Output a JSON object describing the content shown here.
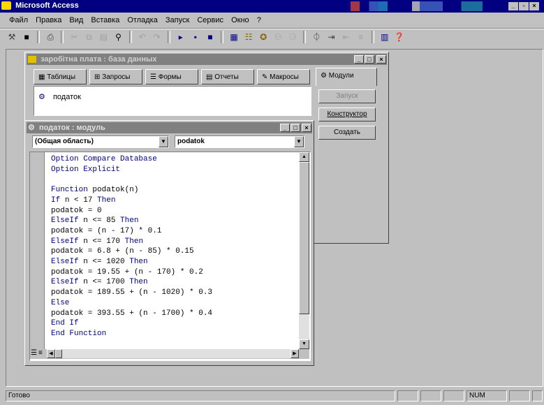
{
  "app": {
    "title": "Microsoft Access"
  },
  "menu": {
    "items": [
      "Файл",
      "Правка",
      "Вид",
      "Вставка",
      "Отладка",
      "Запуск",
      "Сервис",
      "Окно",
      "?"
    ]
  },
  "db_window": {
    "title": "заробітна плата : база данных",
    "tabs": [
      "Таблицы",
      "Запросы",
      "Формы",
      "Отчеты",
      "Макросы",
      "Модули"
    ],
    "list_items": [
      "податок"
    ],
    "buttons": {
      "run": "Запуск",
      "design": "Конструктор",
      "create": "Создать"
    }
  },
  "module_window": {
    "title": "податок : модуль",
    "object_combo": "(Общая область)",
    "proc_combo": "podatok",
    "code": [
      [
        {
          "t": "Option Compare Database",
          "kw": true
        }
      ],
      [
        {
          "t": "Option Explicit",
          "kw": true
        }
      ],
      [
        {
          "t": "",
          "kw": false
        }
      ],
      [
        {
          "t": "Function ",
          "kw": true
        },
        {
          "t": "podatok(n)",
          "kw": false
        }
      ],
      [
        {
          "t": "If ",
          "kw": true
        },
        {
          "t": "n < 17 ",
          "kw": false
        },
        {
          "t": "Then",
          "kw": true
        }
      ],
      [
        {
          "t": "podatok = 0",
          "kw": false
        }
      ],
      [
        {
          "t": "ElseIf ",
          "kw": true
        },
        {
          "t": "n <= 85 ",
          "kw": false
        },
        {
          "t": "Then",
          "kw": true
        }
      ],
      [
        {
          "t": "podatok = (n - 17) * 0.1",
          "kw": false
        }
      ],
      [
        {
          "t": "ElseIf ",
          "kw": true
        },
        {
          "t": "n <= 170 ",
          "kw": false
        },
        {
          "t": "Then",
          "kw": true
        }
      ],
      [
        {
          "t": "podatok = 6.8 + (n - 85) * 0.15",
          "kw": false
        }
      ],
      [
        {
          "t": "ElseIf ",
          "kw": true
        },
        {
          "t": "n <= 1020 ",
          "kw": false
        },
        {
          "t": "Then",
          "kw": true
        }
      ],
      [
        {
          "t": "podatok = 19.55 + (n - 170) * 0.2",
          "kw": false
        }
      ],
      [
        {
          "t": "ElseIf ",
          "kw": true
        },
        {
          "t": "n <= 1700 ",
          "kw": false
        },
        {
          "t": "Then",
          "kw": true
        }
      ],
      [
        {
          "t": "podatok = 189.55 + (n - 1020) * 0.3",
          "kw": false
        }
      ],
      [
        {
          "t": "Else",
          "kw": true
        }
      ],
      [
        {
          "t": "podatok = 393.55 + (n - 1700) * 0.4",
          "kw": false
        }
      ],
      [
        {
          "t": "End If",
          "kw": true
        }
      ],
      [
        {
          "t": "End Function",
          "kw": true
        }
      ]
    ]
  },
  "status": {
    "text": "Готово",
    "num": "NUM"
  }
}
